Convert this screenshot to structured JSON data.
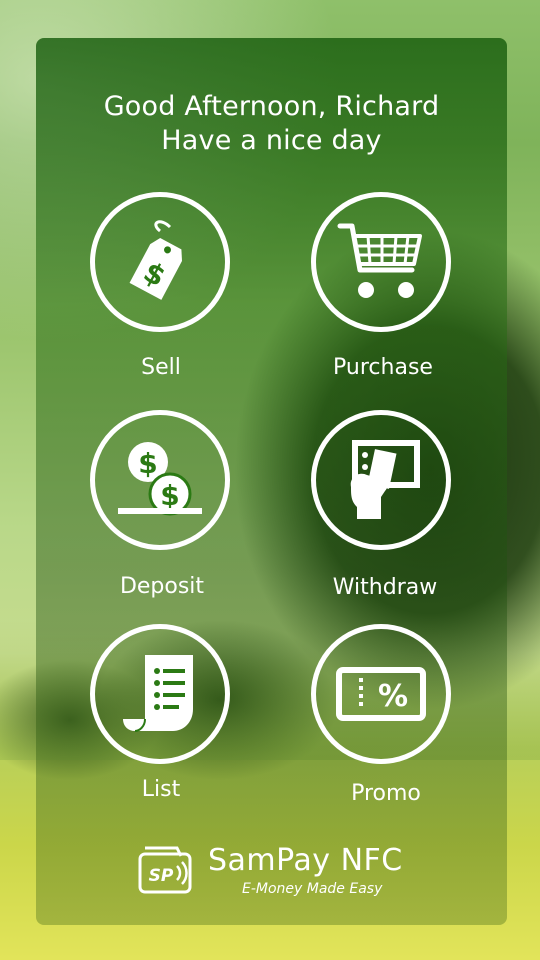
{
  "greeting": {
    "line1": "Good Afternoon, Richard",
    "line2": "Have a nice day"
  },
  "menu": [
    {
      "label": "Sell",
      "icon": "price-tag-icon"
    },
    {
      "label": "Purchase",
      "icon": "shopping-cart-icon"
    },
    {
      "label": "Deposit",
      "icon": "coin-deposit-icon"
    },
    {
      "label": "Withdraw",
      "icon": "atm-withdraw-icon"
    },
    {
      "label": "List",
      "icon": "receipt-list-icon"
    },
    {
      "label": "Promo",
      "icon": "discount-voucher-icon"
    }
  ],
  "brand": {
    "logo_text": "SP",
    "name": "SamPay NFC",
    "tagline": "E-Money Made Easy"
  },
  "colors": {
    "panel": "#1f6a10",
    "icon": "#ffffff"
  }
}
